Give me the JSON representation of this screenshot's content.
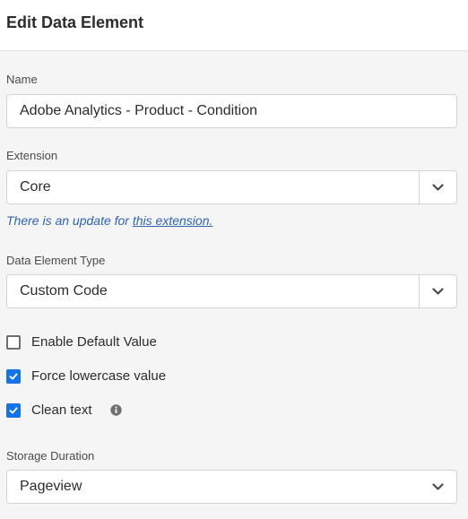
{
  "header": {
    "title": "Edit Data Element"
  },
  "name_field": {
    "label": "Name",
    "value": "Adobe Analytics - Product - Condition"
  },
  "extension_field": {
    "label": "Extension",
    "value": "Core",
    "update_prefix": "There is an update for ",
    "update_link": "this extension."
  },
  "type_field": {
    "label": "Data Element Type",
    "value": "Custom Code"
  },
  "options": [
    {
      "label": "Enable Default Value",
      "checked": false
    },
    {
      "label": "Force lowercase value",
      "checked": true
    },
    {
      "label": "Clean text",
      "checked": true
    }
  ],
  "storage_field": {
    "label": "Storage Duration",
    "value": "Pageview"
  },
  "icons": {
    "select": "chevron-down-icon",
    "info": "info-icon",
    "check": "checkmark-icon"
  },
  "colors": {
    "accent": "#1473e6",
    "link": "#2f62b3",
    "background": "#f5f5f5"
  }
}
